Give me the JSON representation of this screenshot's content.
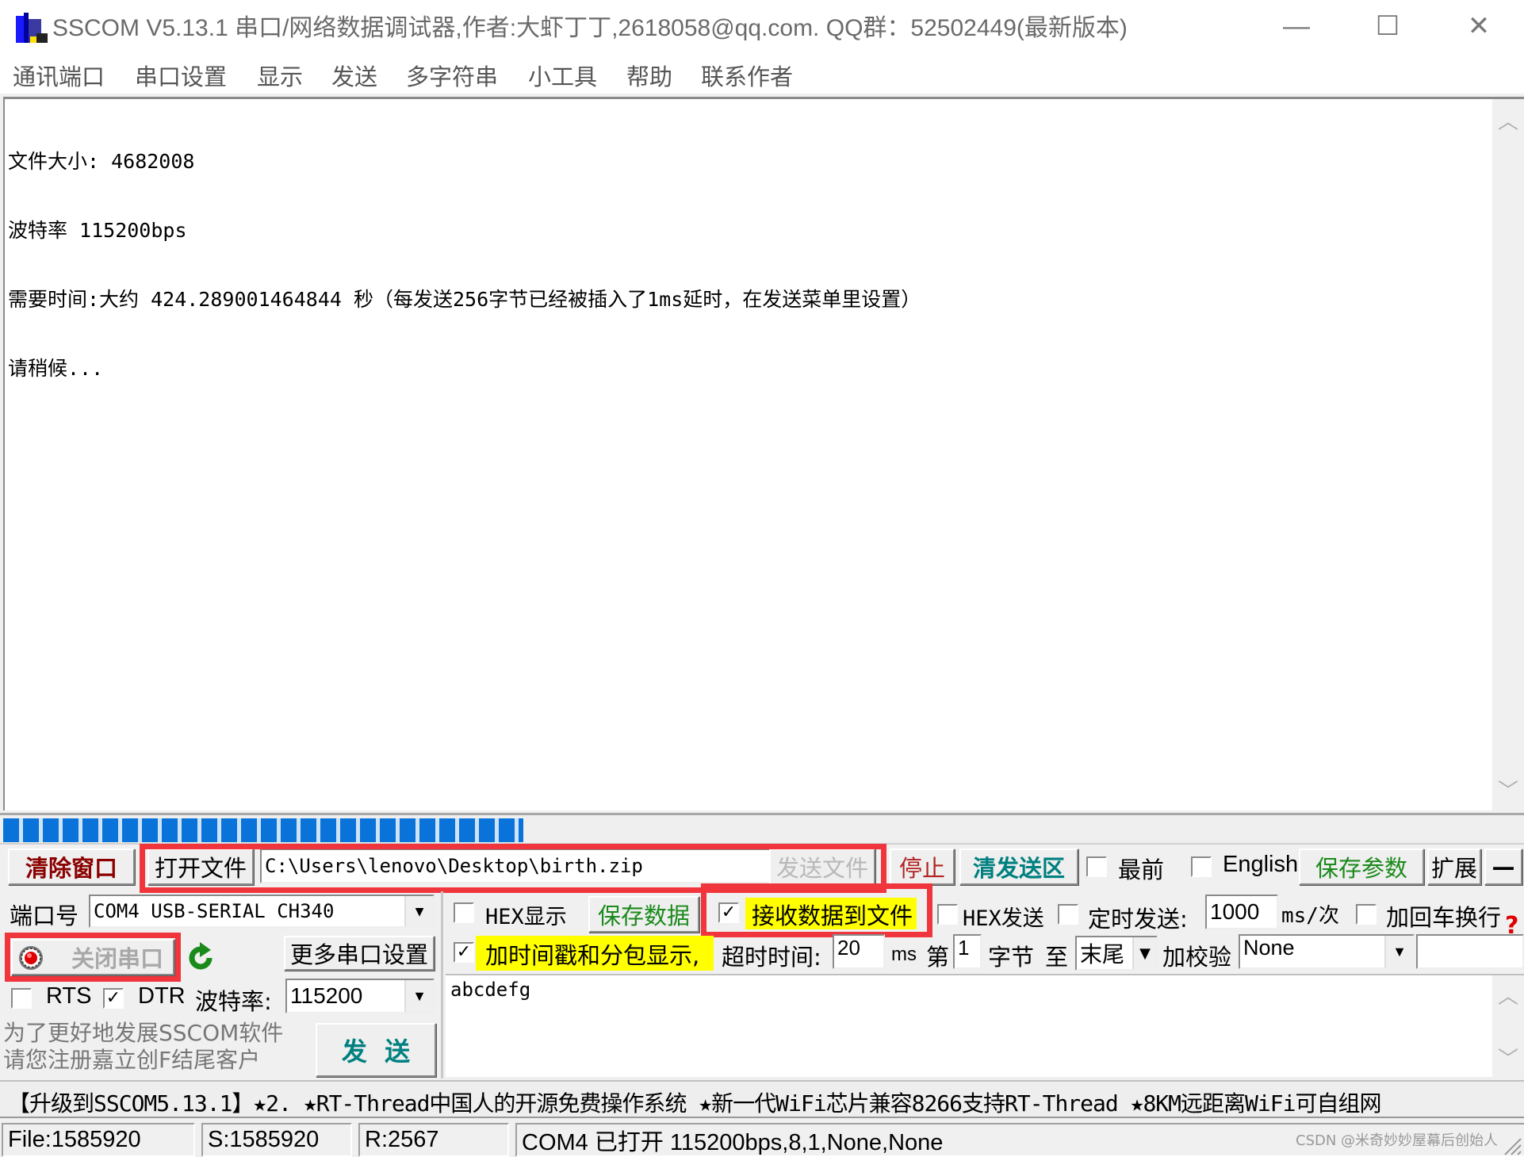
{
  "window": {
    "title": "SSCOM V5.13.1 串口/网络数据调试器,作者:大虾丁丁,2618058@qq.com. QQ群：52502449(最新版本)",
    "minimize_glyph": "—",
    "maximize_glyph": "☐",
    "close_glyph": "✕"
  },
  "menu": [
    "通讯端口",
    "串口设置",
    "显示",
    "发送",
    "多字符串",
    "小工具",
    "帮助",
    "联系作者"
  ],
  "receive": {
    "lines": [
      "文件大小: 4682008",
      "波特率 115200bps",
      "需要时间:大约 424.289001464844 秒（每发送256字节已经被插入了1ms延时，在发送菜单里设置）",
      "请稍候..."
    ],
    "scroll_up_glyph": "︿",
    "scroll_down_glyph": "﹀"
  },
  "progress": {
    "fraction": 0.339
  },
  "toolbar1": {
    "clear_window": "清除窗口",
    "open_file": "打开文件",
    "file_path": "C:\\Users\\lenovo\\Desktop\\birth.zip",
    "send_file": "发送文件",
    "stop": "停止",
    "clear_send": "清发送区",
    "topmost_label": "最前",
    "topmost_checked": false,
    "english_label": "English",
    "english_checked": false,
    "save_params": "保存参数",
    "expand": "扩展",
    "collapse": "—"
  },
  "port": {
    "port_label": "端口号",
    "port_value": "COM4 USB-SERIAL CH340",
    "close_port": "关闭串口",
    "more_settings": "更多串口设置",
    "rts_label": "RTS",
    "rts_checked": false,
    "dtr_label": "DTR",
    "dtr_checked": true,
    "baud_label": "波特率:",
    "baud_value": "115200",
    "notice_line1": "为了更好地发展SSCOM软件",
    "notice_line2": "请您注册嘉立创F结尾客户",
    "send_button": "发  送"
  },
  "options": {
    "hex_display_label": "HEX显示",
    "hex_display_checked": false,
    "save_data": "保存数据",
    "recv_to_file_label": "接收数据到文件",
    "recv_to_file_checked": true,
    "hex_send_label": "HEX发送",
    "hex_send_checked": false,
    "timed_send_label": "定时发送:",
    "timed_send_checked": false,
    "timed_interval": "1000",
    "interval_unit": "ms/次",
    "add_crlf_label": "加回车换行",
    "add_crlf_checked": false,
    "help_glyph": "?",
    "timestamp_label": "加时间戳和分包显示,",
    "timestamp_checked": true,
    "timeout_label": "超时时间:",
    "timeout_value": "20",
    "timeout_unit": "ms",
    "from_label": "第",
    "from_value": "1",
    "byte_label": "字节",
    "to_label": "至",
    "to_value": "末尾",
    "checksum_label": "加校验",
    "checksum_value": "None"
  },
  "send_area": {
    "text": "abcdefg"
  },
  "ticker": "【升级到SSCOM5.13.1】★2. ★RT-Thread中国人的开源免费操作系统 ★新一代WiFi芯片兼容8266支持RT-Thread ★8KM远距离WiFi可自组网",
  "status": {
    "file": "File:1585920",
    "sent": "S:1585920",
    "received": "R:2567",
    "port_status": "COM4 已打开  115200bps,8,1,None,None"
  },
  "watermark": "CSDN @米奇妙妙屋幕后创始人",
  "colors": {
    "highlight_red": "#f0363c",
    "progress_blue": "#0a73d9",
    "highlight_yellow": "#ffff00",
    "dark_red": "#8b0000",
    "teal": "#008080",
    "green": "#1a8a1a"
  }
}
